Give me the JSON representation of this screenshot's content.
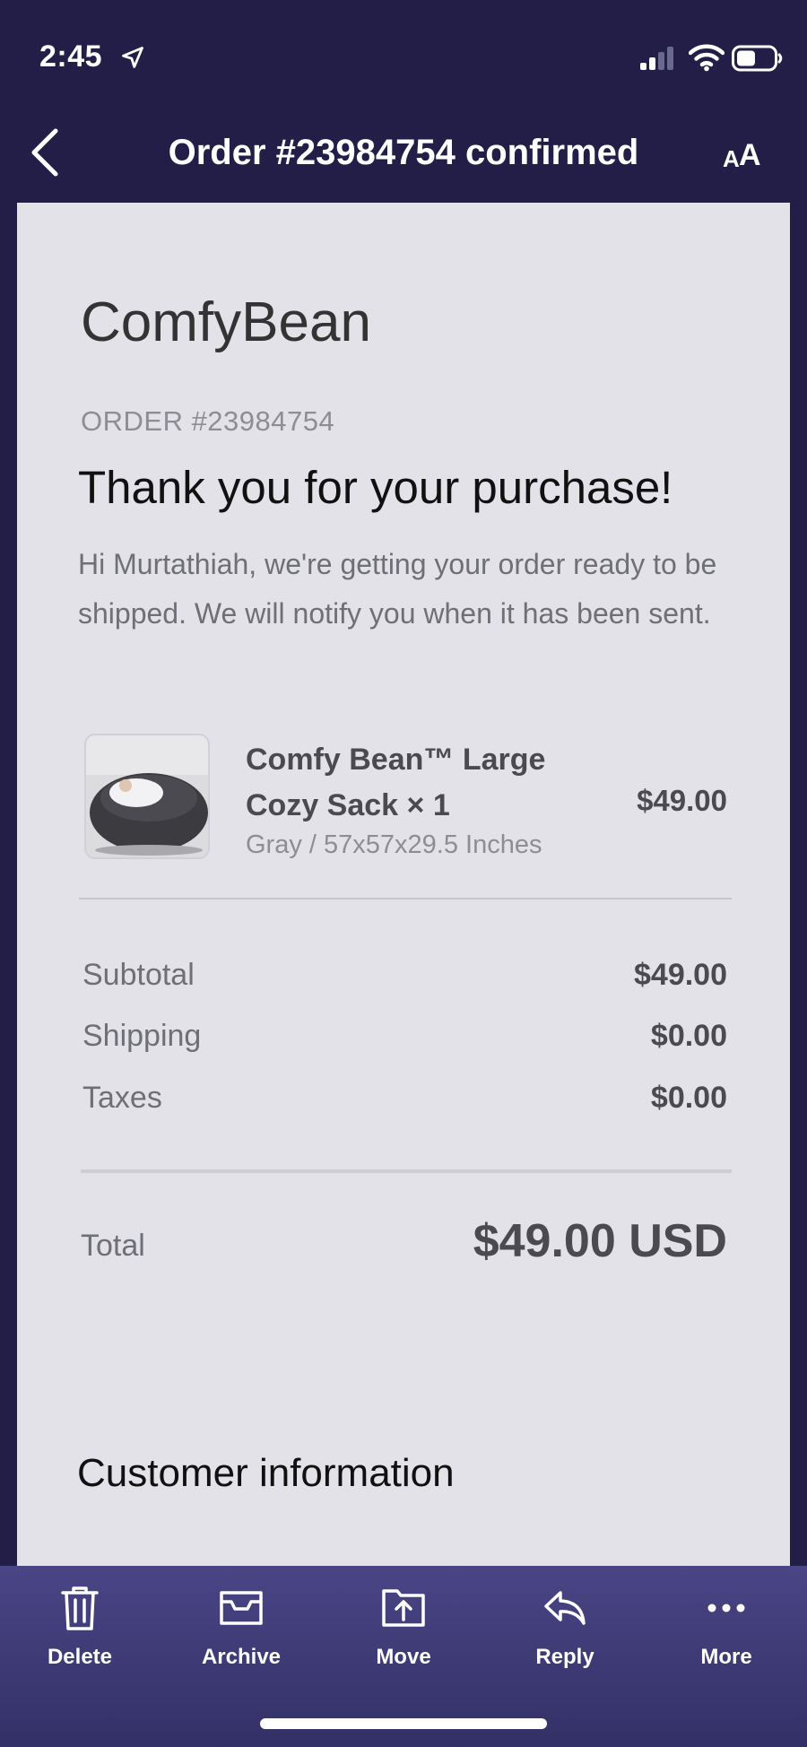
{
  "status_bar": {
    "time": "2:45",
    "icons": [
      "location-arrow-icon",
      "signal-icon",
      "wifi-icon",
      "battery-icon"
    ]
  },
  "nav": {
    "title": "Order #23984754 confirmed",
    "back_icon": "chevron-left-icon",
    "text_size_label_small": "A",
    "text_size_label_big": "A"
  },
  "email": {
    "brand": "ComfyBean",
    "order_label": "ORDER #23984754",
    "heading": "Thank you for your purchase!",
    "intro": "Hi Murtathiah, we're getting your order ready to be shipped. We will notify you when it has been sent.",
    "product": {
      "name": "Comfy Bean™ Large Cozy Sack × 1",
      "variant": "Gray / 57x57x29.5 Inches",
      "price": "$49.00"
    },
    "summary": {
      "subtotal_label": "Subtotal",
      "subtotal_value": "$49.00",
      "shipping_label": "Shipping",
      "shipping_value": "$0.00",
      "taxes_label": "Taxes",
      "taxes_value": "$0.00"
    },
    "total": {
      "label": "Total",
      "value": "$49.00 USD"
    },
    "customer_heading": "Customer information"
  },
  "toolbar": {
    "delete": "Delete",
    "archive": "Archive",
    "move": "Move",
    "reply": "Reply",
    "more": "More"
  },
  "colors": {
    "background": "#221e48",
    "card": "#e2e2e8",
    "toolbar": "#3f3b78"
  }
}
